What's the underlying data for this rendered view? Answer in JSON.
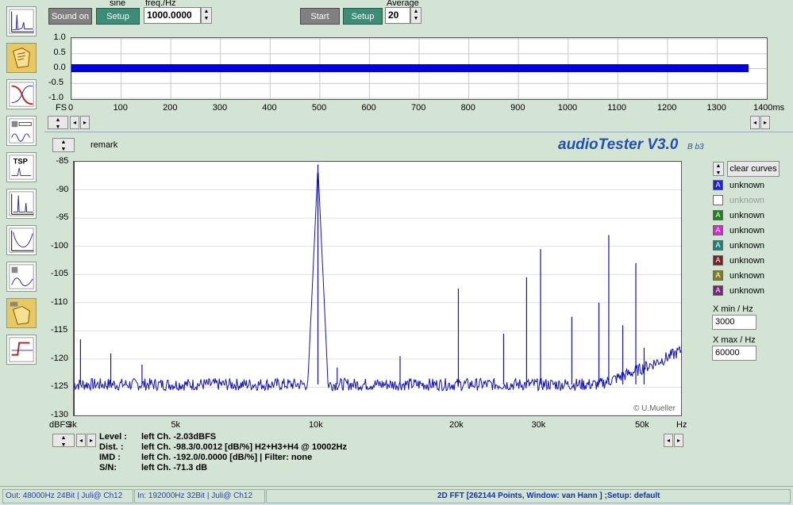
{
  "toolbar": {
    "sound_on": "Sound on",
    "sine_label": "sine",
    "setup1": "Setup",
    "freq_label": "freq./Hz",
    "freq_value": "1000.0000",
    "start": "Start",
    "setup2": "Setup",
    "average_label": "Average",
    "average_value": "20"
  },
  "scope": {
    "y_ticks": [
      "1.0",
      "0.5",
      "0.0",
      "-0.5",
      "-1.0"
    ],
    "fs_label": "FS",
    "x_ticks": [
      "0",
      "100",
      "200",
      "300",
      "400",
      "500",
      "600",
      "700",
      "800",
      "900",
      "1000",
      "1100",
      "1200",
      "1300"
    ],
    "x_unit": "1400ms"
  },
  "remark_label": "remark",
  "brand": "audioTester V3.0",
  "brand_build": "B b3",
  "spectrum": {
    "y_ticks": [
      "-85",
      "-90",
      "-95",
      "-100",
      "-105",
      "-110",
      "-115",
      "-120",
      "-125",
      "-130"
    ],
    "y_unit": "dBFS",
    "x_ticks": [
      "3k",
      "5k",
      "10k",
      "20k",
      "30k",
      "50k"
    ],
    "x_unit": "Hz",
    "credit": "© U.Mueller"
  },
  "legend": {
    "clear": "clear curves",
    "items": [
      {
        "label": "unknown",
        "color": "#2020e0",
        "glyph": "A"
      },
      {
        "label": "unknown",
        "color": "#ffffff",
        "glyph": ""
      },
      {
        "label": "unknown",
        "color": "#208020",
        "glyph": "A"
      },
      {
        "label": "unknown",
        "color": "#e020e0",
        "glyph": "A"
      },
      {
        "label": "unknown",
        "color": "#208080",
        "glyph": "A"
      },
      {
        "label": "unknown",
        "color": "#802020",
        "glyph": "A"
      },
      {
        "label": "unknown",
        "color": "#808020",
        "glyph": "A"
      },
      {
        "label": "unknown",
        "color": "#802080",
        "glyph": "A"
      }
    ],
    "xmin_label": "X min / Hz",
    "xmin_value": "3000",
    "xmax_label": "X max / Hz",
    "xmax_value": "60000"
  },
  "info": {
    "level_label": "Level :",
    "level_value": "left Ch.  -2.03dBFS",
    "dist_label": "Dist. :",
    "dist_value": "left Ch.  -98.3/0.0012 [dB/%] H2+H3+H4 @ 10002Hz",
    "imd_label": "IMD :",
    "imd_value": "left Ch.  -192.0/0.0000 [dB/%]  |   Filter: none",
    "sn_label": "S/N:",
    "sn_value": "left Ch.  -71.3 dB"
  },
  "status": {
    "out": "Out: 48000Hz 24Bit  | Juli@ Ch12",
    "in": "In: 192000Hz 32Bit  | Juli@ Ch12",
    "fft": "2D FFT [262144 Points, Window: van Hann ] ;Setup:  default"
  },
  "chart_data": {
    "type": "line",
    "xlabel": "Hz",
    "ylabel": "dBFS",
    "xscale": "log",
    "xlim": [
      3000,
      60000
    ],
    "ylim": [
      -130,
      -85
    ],
    "noise_floor": -124.5,
    "series": [
      {
        "peaks": [
          {
            "x": 3000,
            "y": -110.5
          },
          {
            "x": 3100,
            "y": -116.5
          },
          {
            "x": 3600,
            "y": -119
          },
          {
            "x": 4200,
            "y": -121
          },
          {
            "x": 10002,
            "y": -85.5
          },
          {
            "x": 11000,
            "y": -121.5
          },
          {
            "x": 15000,
            "y": -119.5
          },
          {
            "x": 20000,
            "y": -107.5
          },
          {
            "x": 25000,
            "y": -115.5
          },
          {
            "x": 28000,
            "y": -105.5
          },
          {
            "x": 30000,
            "y": -100.5
          },
          {
            "x": 35000,
            "y": -112.5
          },
          {
            "x": 40000,
            "y": -110
          },
          {
            "x": 42000,
            "y": -98
          },
          {
            "x": 45000,
            "y": -114
          },
          {
            "x": 48000,
            "y": -103
          },
          {
            "x": 50000,
            "y": -118
          }
        ]
      }
    ]
  }
}
